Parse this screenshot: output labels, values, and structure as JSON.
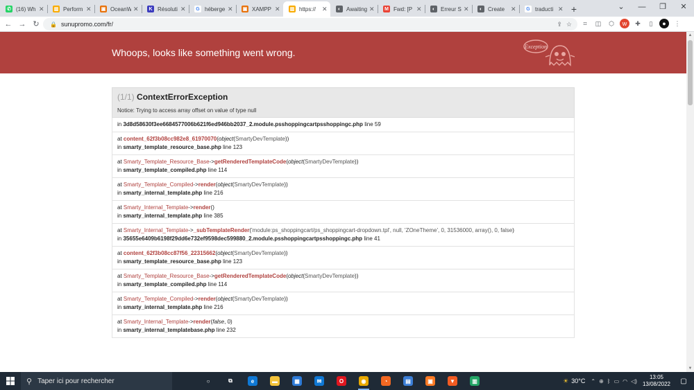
{
  "browser": {
    "tabs": [
      {
        "title": "(16) Wh",
        "color": "#25d366",
        "glyph": "✆"
      },
      {
        "title": "Perform",
        "color": "#f9ab00",
        "glyph": "▥"
      },
      {
        "title": "OceanW",
        "color": "#e8710a",
        "glyph": "▣"
      },
      {
        "title": "Résoluti",
        "color": "#3c3cbe",
        "glyph": "K"
      },
      {
        "title": "héberge",
        "color": "#ffffff",
        "glyph": "G"
      },
      {
        "title": "XAMPP",
        "color": "#e8710a",
        "glyph": "▣"
      },
      {
        "title": "https://",
        "color": "#f9ab00",
        "glyph": "▥"
      },
      {
        "title": "Awaiting",
        "color": "#5f6368",
        "glyph": "◐"
      },
      {
        "title": "Fwd: [P",
        "color": "#ea4335",
        "glyph": "M"
      },
      {
        "title": "Erreur S",
        "color": "#5f6368",
        "glyph": "◐"
      },
      {
        "title": "Create",
        "color": "#5f6368",
        "glyph": "◐"
      },
      {
        "title": "traducti",
        "color": "#ffffff",
        "glyph": "G"
      }
    ],
    "active_tab": 6,
    "url": "sunupromo.com/fr/"
  },
  "page": {
    "banner_title": "Whoops, looks like something went wrong.",
    "ghost_label": "Exception",
    "panel": {
      "count": "(1/1)",
      "exception": "ContextErrorException",
      "message": "Notice: Trying to access array offset on value of type null"
    },
    "trace": [
      {
        "first_in": true,
        "file": "3d8d58630f3ee6684577006b621f6ed946bb2037_2.module.psshoppingcartpsshoppingc.php",
        "line": "line 59"
      },
      {
        "cls": "",
        "fn": "content_62f3b08cc982e8_61970070",
        "args": [
          {
            "t": "obj",
            "v": "SmartyDevTemplate"
          }
        ],
        "file": "smarty_template_resource_base.php",
        "line": "line 123"
      },
      {
        "cls": "Smarty_Template_Resource_Base",
        "fn": "getRenderedTemplateCode",
        "args": [
          {
            "t": "obj",
            "v": "SmartyDevTemplate"
          }
        ],
        "file": "smarty_template_compiled.php",
        "line": "line 114"
      },
      {
        "cls": "Smarty_Template_Compiled",
        "fn": "render",
        "args": [
          {
            "t": "obj",
            "v": "SmartyDevTemplate"
          }
        ],
        "file": "smarty_internal_template.php",
        "line": "line 216"
      },
      {
        "cls": "Smarty_Internal_Template",
        "fn": "render",
        "args": [],
        "file": "smarty_internal_template.php",
        "line": "line 385"
      },
      {
        "cls": "Smarty_Internal_Template",
        "fn": "_subTemplateRender",
        "args_text": "'module:ps_shoppingcart/ps_shoppingcart-dropdown.tpl', null, 'ZOneTheme', 0, 31536000, array(), 0, false",
        "file": "35655e6409b6198f29dd6e732ef9598dec599880_2.module.psshoppingcartpsshoppingc.php",
        "line": "line 41"
      },
      {
        "cls": "",
        "fn": "content_62f3b08cc87f56_22315662",
        "args": [
          {
            "t": "obj",
            "v": "SmartyDevTemplate"
          }
        ],
        "file": "smarty_template_resource_base.php",
        "line": "line 123"
      },
      {
        "cls": "Smarty_Template_Resource_Base",
        "fn": "getRenderedTemplateCode",
        "args": [
          {
            "t": "obj",
            "v": "SmartyDevTemplate"
          }
        ],
        "file": "smarty_template_compiled.php",
        "line": "line 114"
      },
      {
        "cls": "Smarty_Template_Compiled",
        "fn": "render",
        "args": [
          {
            "t": "obj",
            "v": "SmartyDevTemplate"
          }
        ],
        "file": "smarty_internal_template.php",
        "line": "line 216"
      },
      {
        "cls": "Smarty_Internal_Template",
        "fn": "render",
        "args": [
          {
            "t": "lit",
            "v": "false"
          },
          {
            "t": "plain",
            "v": "0"
          }
        ],
        "file": "smarty_internal_templatebase.php",
        "line": "line 232"
      }
    ],
    "labels": {
      "at": "at",
      "in": "in",
      "arrow": "->",
      "object": "object"
    }
  },
  "taskbar": {
    "search_placeholder": "Taper ici pour rechercher",
    "temperature": "30°C",
    "time": "13:05",
    "date": "13/08/2022",
    "apps": [
      {
        "name": "cortana",
        "glyph": "○",
        "color": "transparent"
      },
      {
        "name": "task-view",
        "glyph": "⧉",
        "color": "transparent"
      },
      {
        "name": "edge",
        "glyph": "e",
        "color": "#0f78d4"
      },
      {
        "name": "file-explorer",
        "glyph": "▬",
        "color": "#f3c33b"
      },
      {
        "name": "store",
        "glyph": "▦",
        "color": "#2d7ad6"
      },
      {
        "name": "mail",
        "glyph": "✉",
        "color": "#0f78d4"
      },
      {
        "name": "opera",
        "glyph": "O",
        "color": "#e0161f"
      },
      {
        "name": "chrome",
        "glyph": "◉",
        "color": "#e8a900"
      },
      {
        "name": "rss",
        "glyph": "◔",
        "color": "#f26822"
      },
      {
        "name": "app-blue",
        "glyph": "▤",
        "color": "#3b7ed6"
      },
      {
        "name": "xampp",
        "glyph": "▣",
        "color": "#fb7a24"
      },
      {
        "name": "brave",
        "glyph": "▼",
        "color": "#f15b22"
      },
      {
        "name": "sheets",
        "glyph": "▥",
        "color": "#22a565"
      }
    ],
    "active_app": 7
  },
  "colors": {
    "accent": "#b0413e",
    "taskbar": "#1f2a36"
  }
}
